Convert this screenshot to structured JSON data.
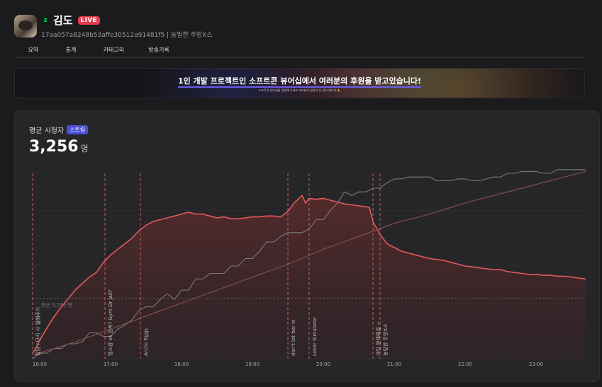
{
  "header": {
    "name": "김도",
    "live_label": "LIVE",
    "platform_icon": "chzzk-icon",
    "subtitle": "17aa057a8248b53affe30512a91481f5 | 농밀한 주방X스"
  },
  "nav": {
    "items": [
      "요약",
      "통계",
      "카테고리",
      "방송기록"
    ]
  },
  "banner": {
    "title": "1인 개발 프로젝트인 소프트콘 뷰어십에서 여러분의 후원을 받고있습니다!",
    "subtitle": "소프트콘 뷰어십을 응원해 주세요 여러분의 관심이 큰 힘이 됩니다 🙏"
  },
  "card": {
    "label": "평균 시청자",
    "badge": "스트림",
    "value": "3,256",
    "unit": "명"
  },
  "chart_data": {
    "type": "line",
    "x_ticks": [
      "16:00",
      "17:00",
      "18:00",
      "19:00",
      "20:00",
      "21:00",
      "22:00",
      "23:00"
    ],
    "x_range_hours": [
      15.9,
      23.7
    ],
    "ylim": [
      0,
      10000
    ],
    "grid": true,
    "average": {
      "value": 3256,
      "label": "평균 3,256 명"
    },
    "series": [
      {
        "color": "#e05a5a",
        "area": true,
        "x": [
          15.9,
          15.95,
          16.0,
          16.1,
          16.2,
          16.3,
          16.4,
          16.5,
          16.6,
          16.7,
          16.8,
          16.9,
          17.0,
          17.1,
          17.2,
          17.3,
          17.4,
          17.5,
          17.6,
          17.7,
          17.8,
          17.9,
          18.0,
          18.1,
          18.2,
          18.3,
          18.4,
          18.5,
          18.6,
          18.7,
          18.8,
          18.9,
          19.0,
          19.1,
          19.2,
          19.3,
          19.4,
          19.5,
          19.6,
          19.7,
          19.75,
          19.8,
          19.9,
          20.0,
          20.1,
          20.2,
          20.3,
          20.4,
          20.5,
          20.6,
          20.65,
          20.7,
          20.8,
          20.9,
          21.0,
          21.1,
          21.2,
          21.3,
          21.4,
          21.5,
          21.6,
          21.7,
          21.8,
          21.9,
          22.0,
          22.1,
          22.2,
          22.3,
          22.4,
          22.5,
          22.6,
          22.7,
          22.8,
          22.9,
          23.0,
          23.1,
          23.2,
          23.3,
          23.4,
          23.5,
          23.6,
          23.7
        ],
        "values": [
          300,
          600,
          1000,
          1650,
          2250,
          2780,
          3230,
          3700,
          4050,
          4400,
          4650,
          5200,
          5600,
          5900,
          6200,
          6500,
          6900,
          7200,
          7400,
          7500,
          7600,
          7700,
          7800,
          7900,
          7800,
          7800,
          7700,
          7600,
          7650,
          7550,
          7550,
          7600,
          7650,
          7650,
          7700,
          7700,
          7650,
          7950,
          8450,
          8800,
          8400,
          8650,
          8600,
          8650,
          8550,
          8450,
          8350,
          8300,
          8250,
          8200,
          8150,
          7400,
          6700,
          6200,
          6000,
          5800,
          5700,
          5600,
          5500,
          5400,
          5350,
          5300,
          5200,
          5100,
          5000,
          4950,
          4900,
          4850,
          4800,
          4800,
          4700,
          4650,
          4600,
          4550,
          4550,
          4500,
          4500,
          4450,
          4450,
          4400,
          4350,
          4300
        ]
      },
      {
        "color": "#7a7a7a",
        "area": false,
        "x": [
          15.9,
          16.0,
          16.1,
          16.2,
          16.3,
          16.4,
          16.5,
          16.6,
          16.7,
          16.8,
          16.9,
          17.0,
          17.1,
          17.2,
          17.3,
          17.4,
          17.5,
          17.6,
          17.7,
          17.8,
          17.9,
          18.0,
          18.1,
          18.2,
          18.3,
          18.4,
          18.5,
          18.6,
          18.7,
          18.8,
          18.9,
          19.0,
          19.1,
          19.2,
          19.3,
          19.4,
          19.5,
          19.6,
          19.7,
          19.8,
          19.9,
          20.0,
          20.1,
          20.2,
          20.3,
          20.4,
          20.5,
          20.6,
          20.7,
          20.8,
          20.9,
          21.0,
          21.1,
          21.2,
          21.3,
          21.4,
          21.5,
          21.6,
          21.7,
          21.8,
          21.9,
          22.0,
          22.1,
          22.2,
          22.3,
          22.4,
          22.5,
          22.6,
          22.7,
          22.8,
          22.9,
          23.0,
          23.1,
          23.2,
          23.3,
          23.4,
          23.5,
          23.6,
          23.7
        ],
        "values": [
          0,
          300,
          300,
          550,
          550,
          800,
          800,
          900,
          1400,
          1400,
          1200,
          1200,
          1600,
          1800,
          2100,
          2600,
          2800,
          2800,
          3200,
          3500,
          3200,
          3700,
          3700,
          4300,
          4300,
          4600,
          4600,
          4600,
          5000,
          5000,
          5400,
          5400,
          5800,
          6300,
          6300,
          6600,
          6800,
          6800,
          6800,
          7000,
          7500,
          7500,
          8000,
          8400,
          9000,
          8800,
          9000,
          9000,
          9200,
          9200,
          9500,
          9700,
          9700,
          9800,
          9800,
          9800,
          9800,
          9600,
          9600,
          9600,
          9700,
          9700,
          9600,
          9600,
          9700,
          9800,
          9800,
          10000,
          10000,
          10100,
          10100,
          10100,
          10000,
          10000,
          10200,
          10200,
          10200,
          10200,
          10200
        ]
      },
      {
        "color": "#8a5050",
        "area": false,
        "x": [
          15.9,
          16.5,
          17.0,
          17.5,
          18.0,
          18.5,
          19.0,
          19.5,
          20.0,
          20.5,
          21.0,
          21.5,
          22.0,
          22.5,
          23.0,
          23.5,
          23.7
        ],
        "values": [
          200,
          900,
          1600,
          2300,
          3000,
          3700,
          4400,
          5100,
          5900,
          6600,
          7300,
          7800,
          8400,
          8900,
          9400,
          9900,
          10100
        ]
      }
    ],
    "events": [
      {
        "x": 15.9,
        "label": "잡담 / 단식 사 필해주기"
      },
      {
        "x": 16.92,
        "label": "헬스장 vs 감옥? Gym Or Jail?"
      },
      {
        "x": 17.42,
        "label": "Arctic Eggs"
      },
      {
        "x": 19.5,
        "label": "don't let her in"
      },
      {
        "x": 19.8,
        "label": "Loser Simulator"
      },
      {
        "x": 20.7,
        "label": "게임 문제해결 ~"
      },
      {
        "x": 20.8,
        "label": "농밀한 주방X스"
      }
    ]
  }
}
